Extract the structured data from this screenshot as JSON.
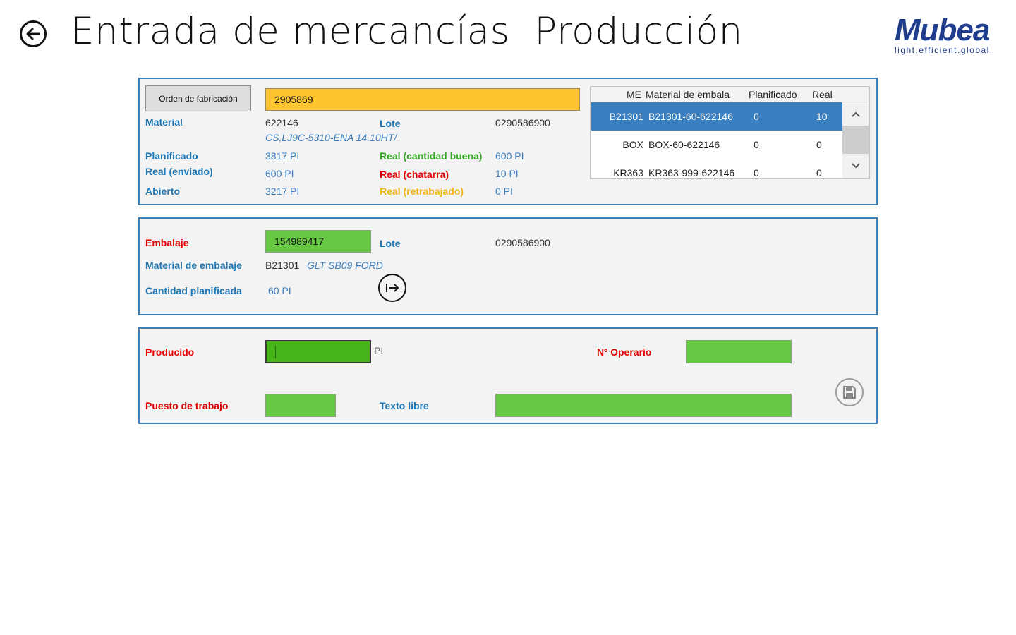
{
  "header": {
    "title": "Entrada de mercancías  Producción",
    "logo": "Mubea",
    "tagline": "light.efficient.global."
  },
  "order": {
    "button_label": "Orden de fabricación",
    "order_value": "2905869",
    "material_label": "Material",
    "material_value": "622146",
    "material_desc": "CS,LJ9C-5310-ENA 14.10HT/",
    "lote_label": "Lote",
    "lote_value": "0290586900",
    "planificado_label": "Planificado",
    "planificado_value": "3817 PI",
    "real_enviado_label": "Real (enviado)",
    "real_enviado_value": "600 PI",
    "abierto_label": "Abierto",
    "abierto_value": "3217 PI",
    "real_buena_label": "Real (cantidad buena)",
    "real_buena_value": "600 PI",
    "real_chatarra_label": "Real (chatarra)",
    "real_chatarra_value": "10 PI",
    "real_retrab_label": "Real (retrabajado)",
    "real_retrab_value": "0 PI"
  },
  "grid": {
    "headers": [
      "ME",
      "Material de embala",
      "Planificado",
      "Real"
    ],
    "rows": [
      {
        "me": "B21301",
        "material": "B21301-60-622146",
        "planificado": "0",
        "real": "10"
      },
      {
        "me": "BOX",
        "material": "BOX-60-622146",
        "planificado": "0",
        "real": "0"
      },
      {
        "me": "KR363",
        "material": "KR363-999-622146",
        "planificado": "0",
        "real": "0"
      }
    ]
  },
  "packaging": {
    "embalaje_label": "Embalaje",
    "embalaje_value": "154989417",
    "lote_label": "Lote",
    "lote_value": "0290586900",
    "material_label": "Material de embalaje",
    "material_code": "B21301",
    "material_desc": "GLT SB09 FORD",
    "cantidad_label": "Cantidad planificada",
    "cantidad_value": "60 PI"
  },
  "production": {
    "producido_label": "Producido",
    "producido_value": "",
    "producido_unit": "PI",
    "operario_label": "Nº Operario",
    "operario_value": "",
    "puesto_label": "Puesto de trabajo",
    "puesto_value": "",
    "texto_label": "Texto libre",
    "texto_value": ""
  },
  "colors": {
    "panel_border": "#3f7fb5",
    "label_blue": "#1f78b4",
    "label_red": "#e00000",
    "label_green": "#3aa62a",
    "label_orange": "#f2b417",
    "input_yellow": "#fec52e",
    "input_green": "#67c844",
    "selected_row": "#3a7fc0"
  },
  "icons": [
    "back-arrow-icon",
    "chevron-up-icon",
    "chevron-down-icon",
    "enter-arrow-icon",
    "save-icon"
  ]
}
